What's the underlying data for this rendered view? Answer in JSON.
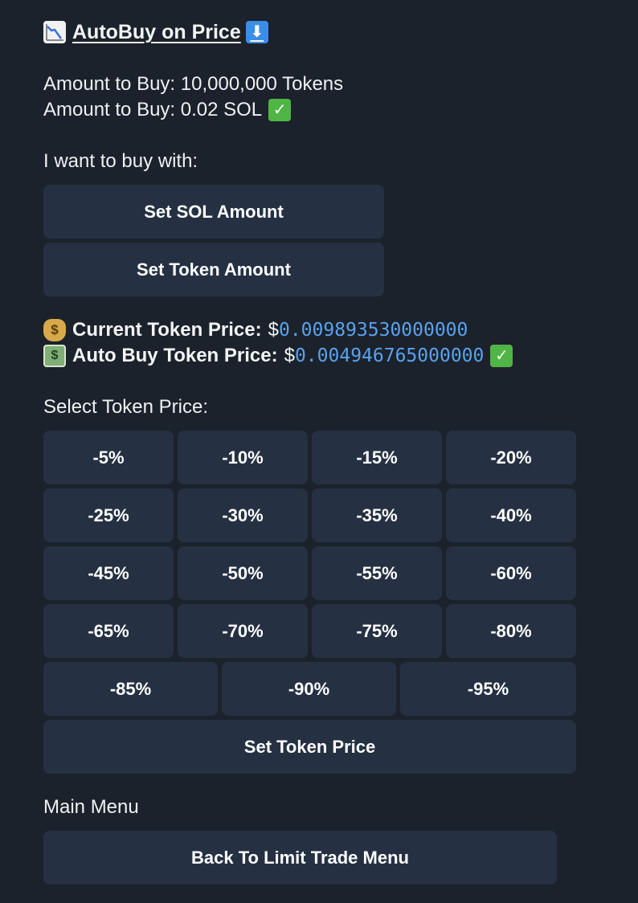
{
  "header": {
    "title": "AutoBuy on Price",
    "chart_icon": "chart-decreasing-icon",
    "arrow_icon": "down-arrow-icon"
  },
  "summary": {
    "token_amount_line": "Amount to Buy: 10,000,000 Tokens",
    "sol_amount_line": "Amount to Buy: 0.02 SOL",
    "check_icon": "check-mark-icon"
  },
  "buy_with": {
    "label": "I want to buy with:",
    "set_sol_label": "Set SOL Amount",
    "set_token_label": "Set Token Amount"
  },
  "prices": {
    "current_label": "Current Token Price:",
    "current_currency": "$",
    "current_value": "0.009893530000000",
    "auto_label": "Auto Buy Token Price:",
    "auto_currency": "$",
    "auto_value": "0.004946765000000",
    "money_bag_icon": "money-bag-icon",
    "dollar_bill_icon": "dollar-banknote-icon"
  },
  "select_price": {
    "label": "Select Token Price:",
    "options": [
      "-5%",
      "-10%",
      "-15%",
      "-20%",
      "-25%",
      "-30%",
      "-35%",
      "-40%",
      "-45%",
      "-50%",
      "-55%",
      "-60%",
      "-65%",
      "-70%",
      "-75%",
      "-80%",
      "-85%",
      "-90%",
      "-95%"
    ],
    "set_price_label": "Set Token Price"
  },
  "menu": {
    "label": "Main Menu",
    "back_label": "Back To Limit Trade Menu"
  },
  "colors": {
    "background": "#1b222b",
    "button": "#253142",
    "accent": "#5aa2ee",
    "check": "#4fb544"
  }
}
